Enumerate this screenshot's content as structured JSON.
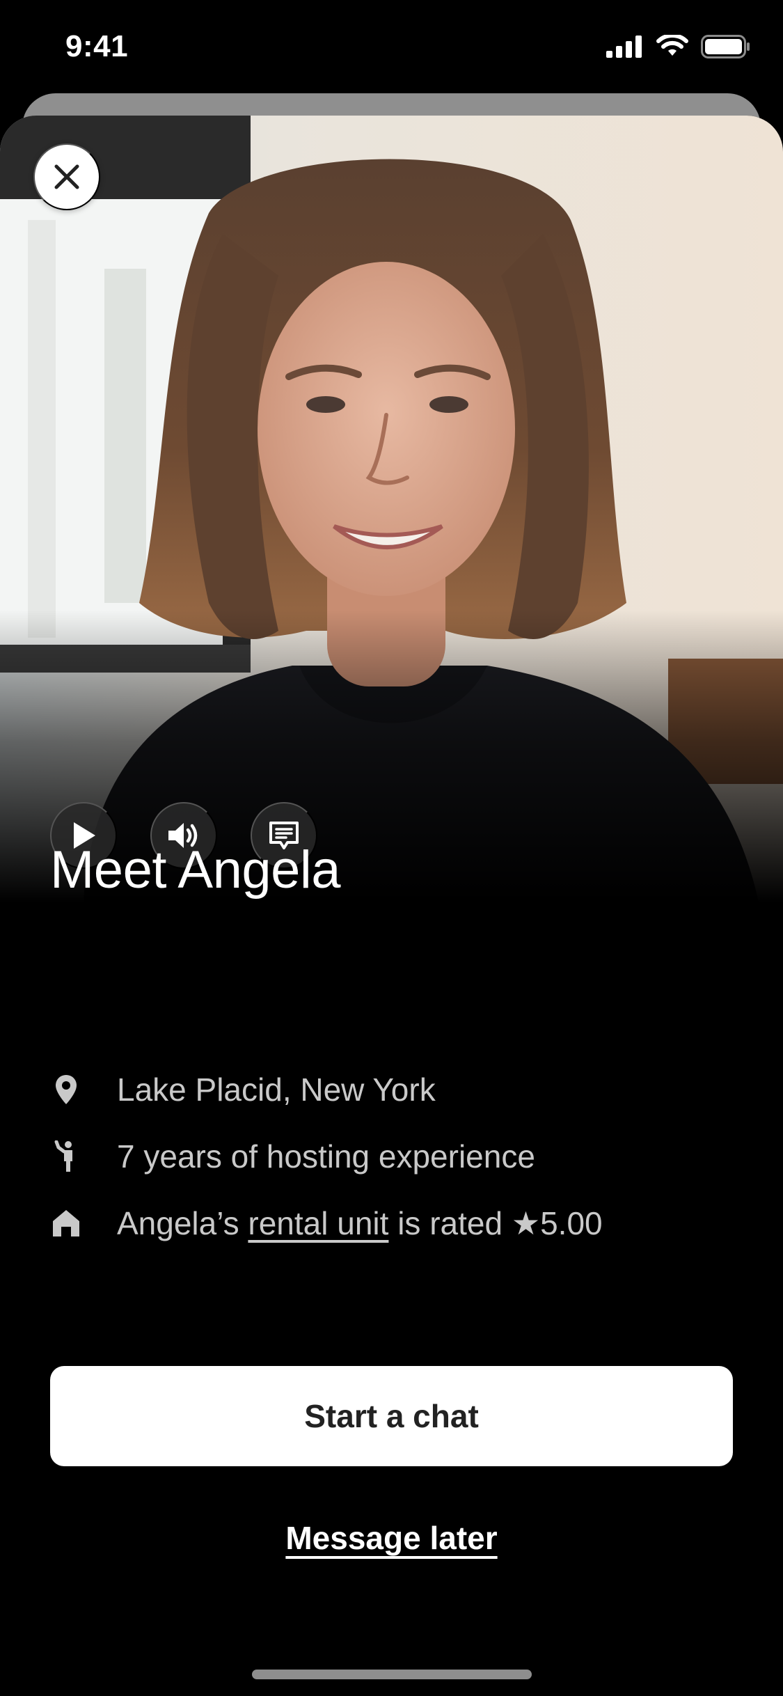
{
  "status_bar": {
    "time": "9:41"
  },
  "icons": {
    "close": "close-icon",
    "play": "play-icon",
    "sound": "speaker-icon",
    "captions": "captions-icon",
    "location": "location-pin-icon",
    "hosting": "person-waving-icon",
    "home": "home-icon",
    "star": "star-icon"
  },
  "profile": {
    "title": "Meet Angela",
    "location": "Lake Placid, New York",
    "experience": "7 years of hosting experience",
    "rating": {
      "prefix": "Angela’s ",
      "link": "rental unit",
      "middle": " is rated ",
      "star": "★",
      "value": "5.00"
    }
  },
  "actions": {
    "primary_label": "Start a chat",
    "secondary_label": "Message later"
  },
  "colors": {
    "background": "#000000",
    "card_back": "#8f8f8f",
    "primary_button_bg": "#ffffff",
    "primary_button_text": "#222222",
    "secondary_text": "#c9c9c9"
  }
}
